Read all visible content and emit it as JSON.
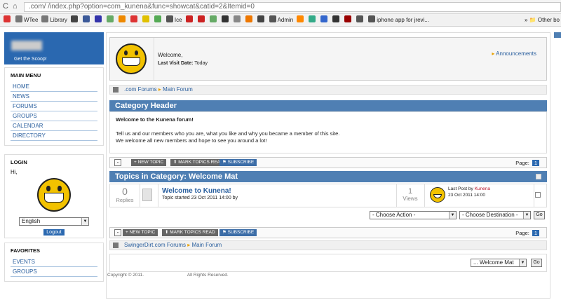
{
  "browser": {
    "url": "                .com/          /index.php?option=com_kunena&func=showcat&catid=2&Itemid=0",
    "bookmarks": [
      {
        "label": "",
        "color": "#d33"
      },
      {
        "label": "WTee",
        "color": "#777"
      },
      {
        "label": "Library",
        "color": "#777"
      },
      {
        "label": "",
        "color": "#444"
      },
      {
        "label": "",
        "color": "#3b5998"
      },
      {
        "label": "",
        "color": "#33a"
      },
      {
        "label": "",
        "color": "#6a6"
      },
      {
        "label": "",
        "color": "#e80"
      },
      {
        "label": "",
        "color": "#d33"
      },
      {
        "label": "",
        "color": "#e0c000"
      },
      {
        "label": "",
        "color": "#5a5"
      },
      {
        "label": "Ice",
        "color": "#555"
      },
      {
        "label": "",
        "color": "#c22"
      },
      {
        "label": "",
        "color": "#c22"
      },
      {
        "label": "",
        "color": "#6a6"
      },
      {
        "label": "",
        "color": "#333"
      },
      {
        "label": "",
        "color": "#888"
      },
      {
        "label": "",
        "color": "#e70"
      },
      {
        "label": "",
        "color": "#444"
      },
      {
        "label": "Admin",
        "color": "#555"
      },
      {
        "label": "",
        "color": "#f80"
      },
      {
        "label": "",
        "color": "#3a8"
      },
      {
        "label": "",
        "color": "#36c"
      },
      {
        "label": "",
        "color": "#333"
      },
      {
        "label": "",
        "color": "#900"
      },
      {
        "label": "",
        "color": "#555"
      },
      {
        "label": "iphone app for jrevi...",
        "color": "#555"
      }
    ],
    "other_bookmarks": "Other bo"
  },
  "logo": {
    "tagline": "Get the Scoop!"
  },
  "main_menu": {
    "title": "MAIN MENU",
    "items": [
      "HOME",
      "NEWS",
      "FORUMS",
      "GROUPS",
      "CALENDAR",
      "DIRECTORY"
    ]
  },
  "login": {
    "title": "LOGIN",
    "greeting": "Hi,",
    "language": "English",
    "logout": "Logout"
  },
  "favorites": {
    "title": "FAVORITES",
    "items": [
      "EVENTS",
      "GROUPS"
    ]
  },
  "welcome": {
    "text": "Welcome,",
    "last_visit_label": "Last Visit Date:",
    "last_visit_value": "Today",
    "announcements": "Announcements"
  },
  "breadcrumb_top": {
    "site": ".com Forums",
    "sep": "▸",
    "current": "Main Forum"
  },
  "category_header": {
    "title": "Category Header",
    "heading": "Welcome to the Kunena forum!",
    "line1": "Tell us and our members who you are, what you like and why you became a member of this site.",
    "line2": "We welcome all new members and hope to see you around a lot!"
  },
  "actions": {
    "new_topic": "NEW TOPIC",
    "mark_read": "MARK TOPICS READ",
    "subscribe": "SUBSCRIBE",
    "page_label": "Page:",
    "page_value": "1"
  },
  "topics_header": "Topics in Category: Welcome Mat",
  "topic": {
    "replies_count": "0",
    "replies_label": "Replies",
    "title": "Welcome to Kunena!",
    "started": "Topic started 23 Oct 2011 14:00 by",
    "views_count": "1",
    "views_label": "Views",
    "last_post_label": "Last Post",
    "by": "by",
    "last_post_author": "Kunena",
    "last_post_date": "23 Oct 2011 14:00"
  },
  "choose_action": "- Choose Action -",
  "choose_destination": "- Choose Destination -",
  "go": "Go",
  "breadcrumb_bottom": {
    "site": "SwingerDirt.com Forums",
    "sep": "▸",
    "current": "Main Forum"
  },
  "jump_select": "... Welcome Mat",
  "footer": {
    "copyright": "Copyright © 2011.",
    "rights": "All Rights Reserved."
  }
}
